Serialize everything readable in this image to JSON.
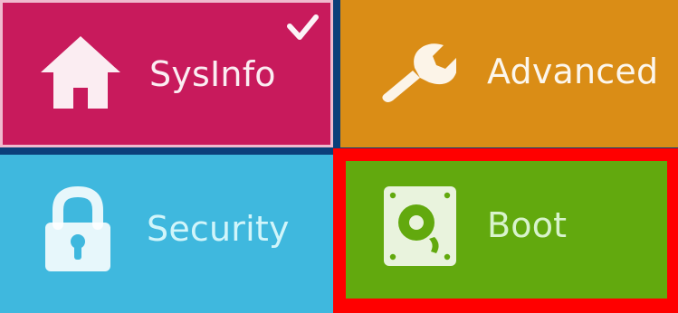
{
  "menu": {
    "tiles": [
      {
        "key": "sysinfo",
        "label": "SysInfo",
        "icon": "home-icon",
        "color": "#c81a5c",
        "selected": true
      },
      {
        "key": "advanced",
        "label": "Advanced",
        "icon": "wrench-icon",
        "color": "#da8d16",
        "selected": false
      },
      {
        "key": "security",
        "label": "Security",
        "icon": "lock-icon",
        "color": "#3fb8de",
        "selected": false
      },
      {
        "key": "boot",
        "label": "Boot",
        "icon": "hard-drive-icon",
        "color": "#62a90e",
        "selected": false,
        "highlight_color": "#ff0000"
      }
    ]
  }
}
